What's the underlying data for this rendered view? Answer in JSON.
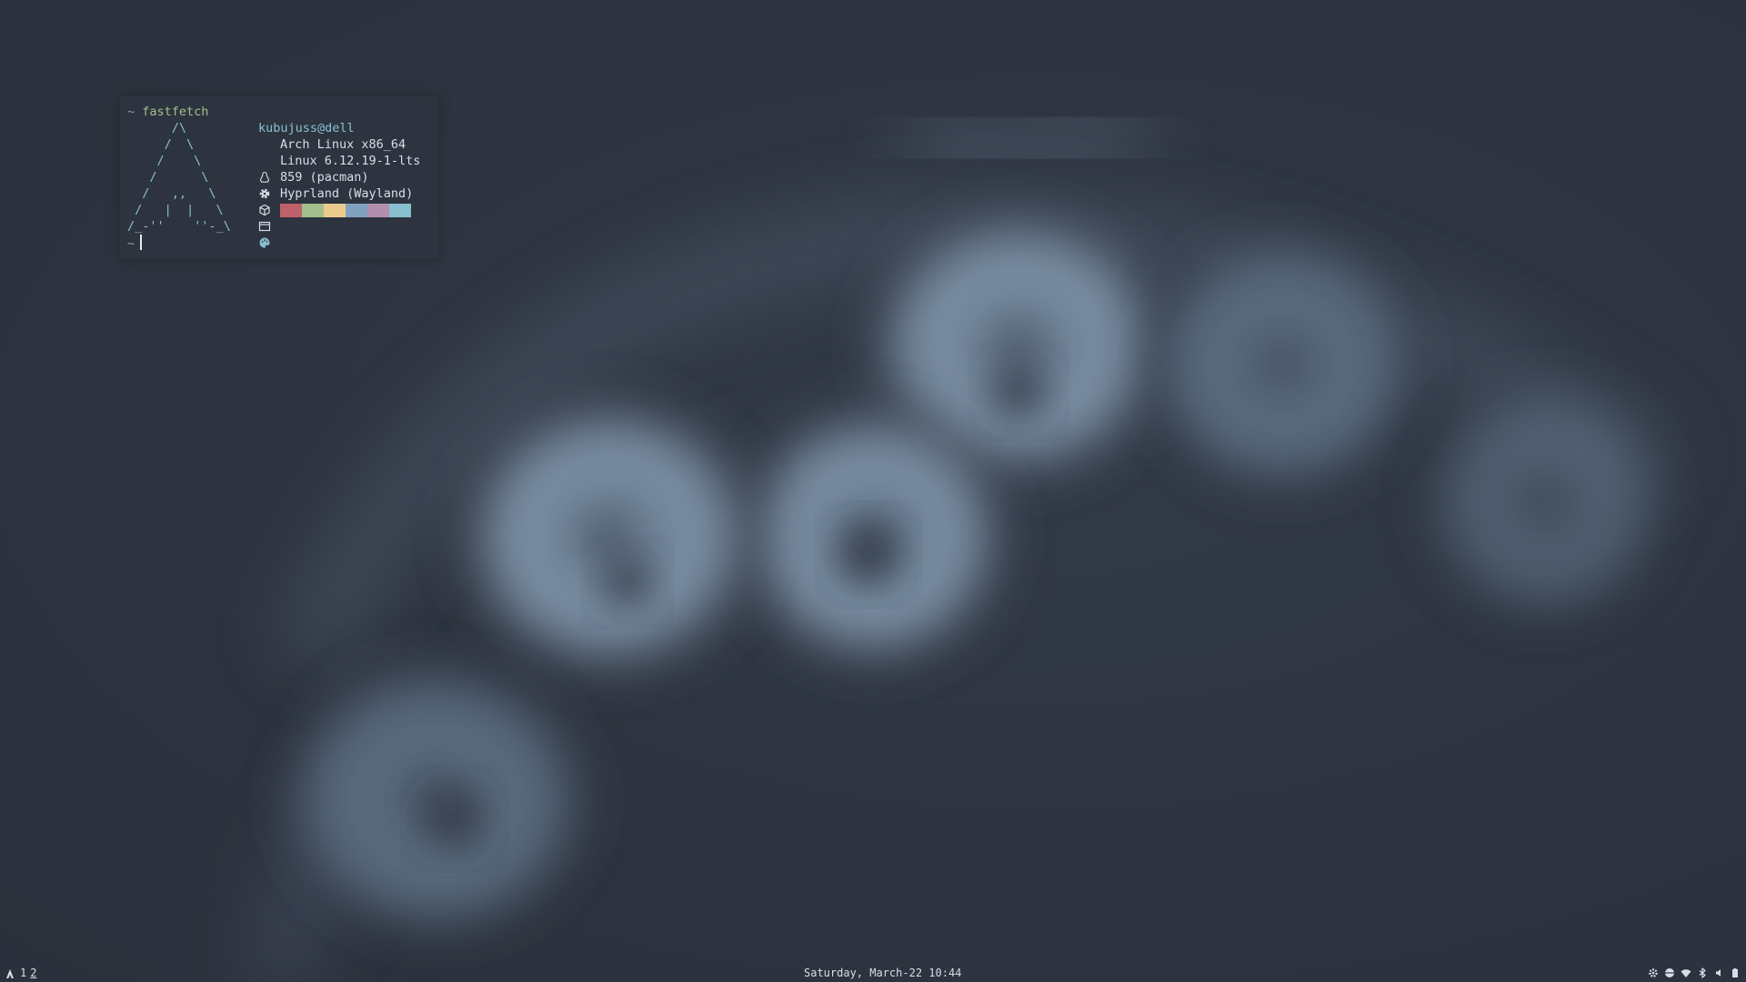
{
  "terminal": {
    "prompt_symbol": "~",
    "command": "fastfetch",
    "logo_lines": [
      "      /\\",
      "     /  \\",
      "    /    \\",
      "   /      \\",
      "  /   ,,   \\",
      " /   |  |   \\",
      "/_-''    ''-_\\"
    ],
    "user_host": "kubujuss@dell",
    "os": "Arch Linux x86_64",
    "kernel": "Linux 6.12.19-1-lts",
    "packages": "859 (pacman)",
    "wm": "Hyprland (Wayland)",
    "palette": [
      "#bf616a",
      "#a3be8c",
      "#ebcb8b",
      "#81a1c1",
      "#b48ead",
      "#88c0d0"
    ],
    "second_prompt": "~",
    "icons": {
      "os": "tux-icon",
      "kernel": "gear-icon",
      "packages": "package-icon",
      "wm": "window-icon",
      "palette": "palette-icon"
    }
  },
  "bar": {
    "workspaces": [
      {
        "label": "1",
        "active": false
      },
      {
        "label": "2",
        "active": true
      }
    ],
    "clock_icon": "calendar-icon",
    "clock_text": "Saturday, March-22 10:44",
    "tray_icons": [
      "settings-icon",
      "globe-icon",
      "wifi-icon",
      "bluetooth-icon",
      "volume-icon",
      "battery-icon"
    ]
  },
  "colors": {
    "background": "#2e3440",
    "accent": "#88c0d0",
    "command": "#a3be8c",
    "text": "#d8dee9"
  }
}
